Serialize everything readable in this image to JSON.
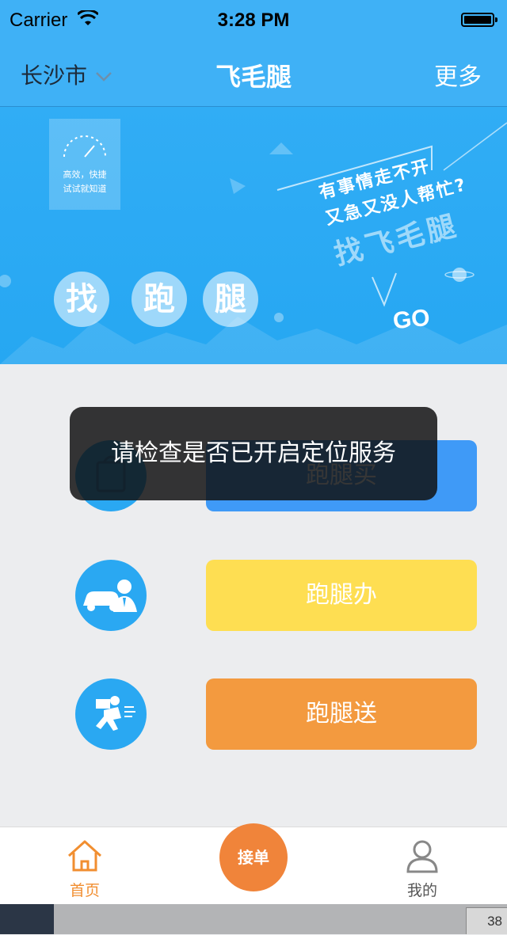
{
  "status_bar": {
    "carrier": "Carrier",
    "time": "3:28 PM"
  },
  "nav": {
    "city": "长沙市",
    "title": "飞毛腿",
    "more": "更多"
  },
  "banner": {
    "gauge_line1": "高效，快捷",
    "gauge_line2": "试试就知道",
    "chars": [
      "找",
      "跑",
      "腿"
    ],
    "slogan_line1": "有事情走不开",
    "slogan_line2": "又急又没人帮忙?",
    "slogan_line3": "找飞毛腿",
    "go": "GO"
  },
  "services": [
    {
      "label": "跑腿买",
      "color": "#3f9af7"
    },
    {
      "label": "跑腿办",
      "color": "#fede52"
    },
    {
      "label": "跑腿送",
      "color": "#f39a3f"
    }
  ],
  "toast": {
    "message": "请检查是否已开启定位服务"
  },
  "tab_bar": {
    "home": "首页",
    "accept": "接单",
    "mine": "我的"
  },
  "bottom_strip": {
    "page_number": "38"
  }
}
